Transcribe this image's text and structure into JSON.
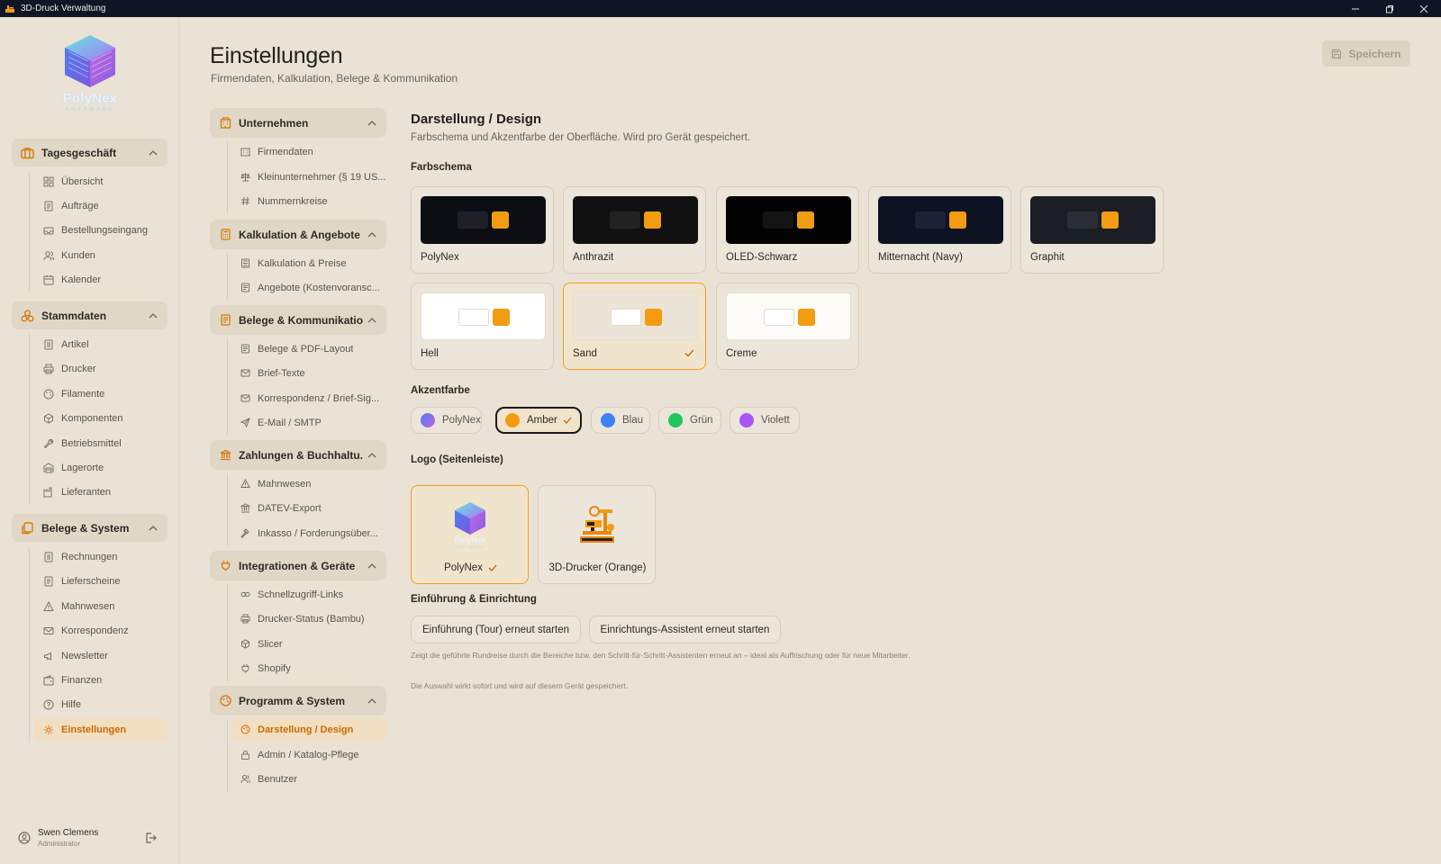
{
  "window": {
    "title": "3D-Druck Verwaltung"
  },
  "logo": {
    "name": "PolyNex",
    "sub": "SOFTWARE"
  },
  "sidebar": {
    "groups": [
      {
        "label": "Tagesgeschäft",
        "icon": "briefcase-icon",
        "items": [
          {
            "label": "Übersicht",
            "icon": "dashboard-icon"
          },
          {
            "label": "Aufträge",
            "icon": "document-icon"
          },
          {
            "label": "Bestellungseingang",
            "icon": "inbox-icon"
          },
          {
            "label": "Kunden",
            "icon": "users-icon"
          },
          {
            "label": "Kalender",
            "icon": "calendar-icon"
          }
        ]
      },
      {
        "label": "Stammdaten",
        "icon": "boxes-icon",
        "items": [
          {
            "label": "Artikel",
            "icon": "list-icon"
          },
          {
            "label": "Drucker",
            "icon": "printer-icon"
          },
          {
            "label": "Filamente",
            "icon": "palette-icon"
          },
          {
            "label": "Komponenten",
            "icon": "cube-icon"
          },
          {
            "label": "Betriebsmittel",
            "icon": "wrench-icon"
          },
          {
            "label": "Lagerorte",
            "icon": "warehouse-icon"
          },
          {
            "label": "Lieferanten",
            "icon": "factory-icon"
          }
        ]
      },
      {
        "label": "Belege & System",
        "icon": "files-icon",
        "items": [
          {
            "label": "Rechnungen",
            "icon": "receipt-icon"
          },
          {
            "label": "Lieferscheine",
            "icon": "document-icon"
          },
          {
            "label": "Mahnwesen",
            "icon": "warning-icon"
          },
          {
            "label": "Korrespondenz",
            "icon": "mail-icon"
          },
          {
            "label": "Newsletter",
            "icon": "megaphone-icon"
          },
          {
            "label": "Finanzen",
            "icon": "wallet-icon"
          },
          {
            "label": "Hilfe",
            "icon": "help-icon"
          },
          {
            "label": "Einstellungen",
            "icon": "gear-icon"
          }
        ]
      }
    ],
    "user": {
      "name": "Swen Clemens",
      "role": "Administrator"
    }
  },
  "header": {
    "title": "Einstellungen",
    "subtitle": "Firmendaten, Kalkulation, Belege & Kommunikation",
    "save_label": "Speichern"
  },
  "settings_nav": [
    {
      "label": "Unternehmen",
      "items": [
        "Firmendaten",
        "Kleinunternehmer (§ 19 US...",
        "Nummernkreise"
      ]
    },
    {
      "label": "Kalkulation & Angebote",
      "items": [
        "Kalkulation & Preise",
        "Angebote (Kostenvoransc..."
      ]
    },
    {
      "label": "Belege & Kommunikation",
      "items": [
        "Belege & PDF-Layout",
        "Brief-Texte",
        "Korrespondenz / Brief-Sig...",
        "E-Mail / SMTP"
      ]
    },
    {
      "label": "Zahlungen & Buchhaltu...",
      "items": [
        "Mahnwesen",
        "DATEV-Export",
        "Inkasso / Forderungsüber..."
      ]
    },
    {
      "label": "Integrationen & Geräte",
      "items": [
        "Schnellzugriff-Links",
        "Drucker-Status (Bambu)",
        "Slicer",
        "Shopify"
      ]
    },
    {
      "label": "Programm & System",
      "items": [
        "Darstellung / Design",
        "Admin / Katalog-Pflege",
        "Benutzer"
      ]
    }
  ],
  "content": {
    "title": "Darstellung / Design",
    "subtitle": "Farbschema und Akzentfarbe der Oberfläche. Wird pro Gerät gespeichert.",
    "color_scheme_label": "Farbschema",
    "themes": [
      {
        "name": "PolyNex",
        "bg": "#0c0e14",
        "block": "#1d2029",
        "selected": false
      },
      {
        "name": "Anthrazit",
        "bg": "#111111",
        "block": "#222222",
        "selected": false
      },
      {
        "name": "OLED-Schwarz",
        "bg": "#030303",
        "block": "#141414",
        "selected": false
      },
      {
        "name": "Mitternacht (Navy)",
        "bg": "#0d1322",
        "block": "#1b2334",
        "selected": false
      },
      {
        "name": "Graphit",
        "bg": "#1b1e25",
        "block": "#2a2e36",
        "selected": false
      },
      {
        "name": "Hell",
        "bg": "#ffffff",
        "block": "#ffffff",
        "selected": false
      },
      {
        "name": "Sand",
        "bg": "#ece4d7",
        "block": "#ffffff",
        "selected": true
      },
      {
        "name": "Creme",
        "bg": "#fefcf8",
        "block": "#ffffff",
        "selected": false
      }
    ],
    "accent_label": "Akzentfarbe",
    "accents": [
      {
        "name": "PolyNex",
        "color": "#7b6cf0",
        "selected": false
      },
      {
        "name": "Amber",
        "color": "#f39c12",
        "selected": true
      },
      {
        "name": "Blau",
        "color": "#3b82f6",
        "selected": false
      },
      {
        "name": "Grün",
        "color": "#22c55e",
        "selected": false
      },
      {
        "name": "Violett",
        "color": "#a855f7",
        "selected": false
      }
    ],
    "logo_label": "Logo (Seitenleiste)",
    "logos": [
      {
        "name": "PolyNex",
        "selected": true
      },
      {
        "name": "3D-Drucker (Orange)",
        "selected": false
      }
    ],
    "intro_label": "Einführung & Einrichtung",
    "tour_button": "Einführung (Tour) erneut starten",
    "wizard_button": "Einrichtungs-Assistent erneut starten",
    "intro_note": "Zeigt die geführte Rundreise durch die Bereiche bzw. den Schritt-für-Schritt-Assistenten erneut an – ideal als Auffrischung oder für neue Mitarbeiter.",
    "footer_note": "Die Auswahl wirkt sofort und wird auf diesem Gerät gespeichert."
  },
  "colors": {
    "accent": "#f39c12",
    "active_bg": "#f2dec0",
    "active_text": "#c96a05"
  }
}
